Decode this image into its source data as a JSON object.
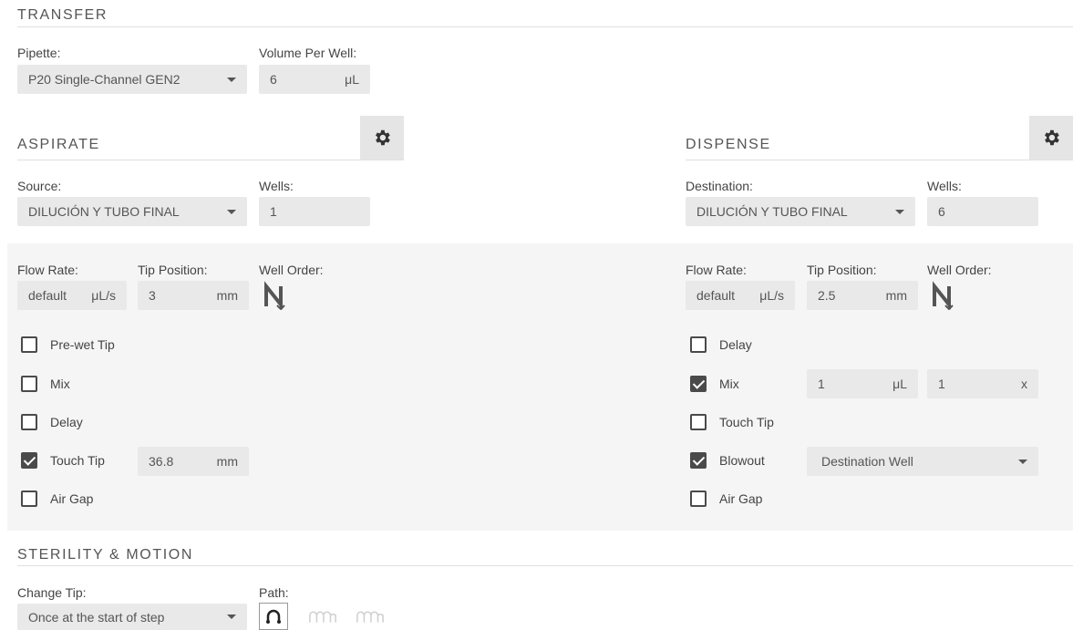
{
  "transfer": {
    "title": "TRANSFER",
    "pipette_label": "Pipette:",
    "pipette_value": "P20 Single-Channel GEN2",
    "volume_label": "Volume Per Well:",
    "volume_value": "6",
    "volume_unit": "μL"
  },
  "aspirate": {
    "title": "ASPIRATE",
    "source_label": "Source:",
    "source_value": "DILUCIÓN Y TUBO FINAL",
    "wells_label": "Wells:",
    "wells_value": "1",
    "flow_rate_label": "Flow Rate:",
    "flow_rate_value": "default",
    "flow_rate_unit": "μL/s",
    "tip_position_label": "Tip Position:",
    "tip_position_value": "3",
    "tip_position_unit": "mm",
    "well_order_label": "Well Order:",
    "options": [
      {
        "label": "Pre-wet Tip",
        "checked": false
      },
      {
        "label": "Mix",
        "checked": false
      },
      {
        "label": "Delay",
        "checked": false
      },
      {
        "label": "Touch Tip",
        "checked": true,
        "value": "36.8",
        "unit": "mm"
      },
      {
        "label": "Air Gap",
        "checked": false
      }
    ]
  },
  "dispense": {
    "title": "DISPENSE",
    "destination_label": "Destination:",
    "destination_value": "DILUCIÓN Y TUBO FINAL",
    "wells_label": "Wells:",
    "wells_value": "6",
    "flow_rate_label": "Flow Rate:",
    "flow_rate_value": "default",
    "flow_rate_unit": "μL/s",
    "tip_position_label": "Tip Position:",
    "tip_position_value": "2.5",
    "tip_position_unit": "mm",
    "well_order_label": "Well Order:",
    "options": [
      {
        "label": "Delay",
        "checked": false
      },
      {
        "label": "Mix",
        "checked": true,
        "volume": "1",
        "volume_unit": "μL",
        "times": "1",
        "times_unit": "x"
      },
      {
        "label": "Touch Tip",
        "checked": false
      },
      {
        "label": "Blowout",
        "checked": true,
        "value": "Destination Well"
      },
      {
        "label": "Air Gap",
        "checked": false
      }
    ]
  },
  "sterility": {
    "title": "STERILITY & MOTION",
    "change_tip_label": "Change Tip:",
    "change_tip_value": "Once at the start of step",
    "path_label": "Path:",
    "path_options": [
      "single-path-icon",
      "multi-aspirate-icon",
      "multi-dispense-icon"
    ]
  },
  "colors": {
    "field_bg": "#e9e9e9",
    "band_bg": "#f5f5f5",
    "text": "#4a4a4a"
  }
}
